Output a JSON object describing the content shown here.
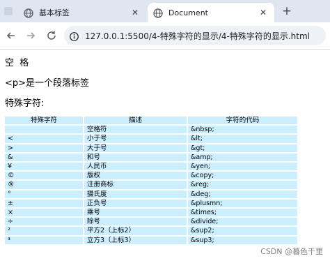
{
  "browser": {
    "tabs": [
      {
        "title": "基本标签",
        "icon": "globe-icon",
        "active": false
      },
      {
        "title": "Document",
        "icon": "globe-icon",
        "active": true
      }
    ],
    "close_glyph": "✕",
    "new_tab_glyph": "+",
    "address": "127.0.0.1:5500/4-特殊字符的显示/4-特殊字符的显示.html"
  },
  "page": {
    "space_heading": "空  格",
    "p_tag_text": "<p>是一个段落标签",
    "special_chars_title": "特殊字符:",
    "table": {
      "headers": [
        "特殊字符",
        "描述",
        "字符的代码"
      ],
      "rows": [
        [
          "",
          "空格符",
          "&nbsp;"
        ],
        [
          "<",
          "小于号",
          "&lt;"
        ],
        [
          ">",
          "大于号",
          "&gt;"
        ],
        [
          "&",
          "和号",
          "&amp;"
        ],
        [
          "¥",
          "人民币",
          "&yen;"
        ],
        [
          "©",
          "版权",
          "&copy;"
        ],
        [
          "®",
          "注册商标",
          "&reg;"
        ],
        [
          "°",
          "摄氏度",
          "&deg;"
        ],
        [
          "±",
          "正负号",
          "&plusmn;"
        ],
        [
          "×",
          "乘号",
          "&times;"
        ],
        [
          "÷",
          "除号",
          "&divide;"
        ],
        [
          "²",
          "平方2（上标2）",
          "&sup2;"
        ],
        [
          "³",
          "立方3（上标3）",
          "&sup3;"
        ]
      ]
    }
  },
  "watermark": "CSDN @暮色千里"
}
